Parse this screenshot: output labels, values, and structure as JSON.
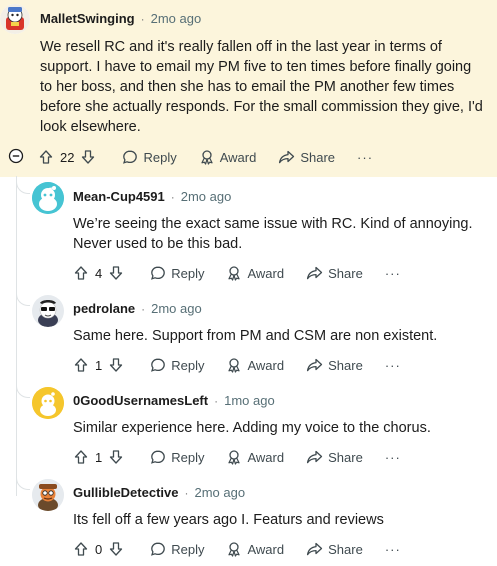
{
  "comments": [
    {
      "user": "MalletSwinging",
      "time": "2mo ago",
      "body_lines": [
        "We resell RC and it's really fallen off in the last year in terms of",
        "support. I have to email my PM five to ten times before finally going",
        "to her boss, and then she has to email the PM another few times",
        "before she actually responds. For the small commission they give, I'd",
        "look elsewhere."
      ],
      "votes": "22",
      "reply": "Reply",
      "award": "Award",
      "share": "Share",
      "more": "···"
    },
    {
      "user": "Mean-Cup4591",
      "time": "2mo ago",
      "body_lines": [
        "We’re seeing the exact same issue with RC. Kind of annoying.",
        "Never used to be this bad."
      ],
      "votes": "4",
      "reply": "Reply",
      "award": "Award",
      "share": "Share",
      "more": "···"
    },
    {
      "user": "pedrolane",
      "time": "2mo ago",
      "body_lines": [
        "Same here. Support from PM and CSM are non existent."
      ],
      "votes": "1",
      "reply": "Reply",
      "award": "Award",
      "share": "Share",
      "more": "···"
    },
    {
      "user": "0GoodUsernamesLeft",
      "time": "1mo ago",
      "body_lines": [
        "Similar experience here. Adding my voice to the chorus."
      ],
      "votes": "1",
      "reply": "Reply",
      "award": "Award",
      "share": "Share",
      "more": "···"
    },
    {
      "user": "GullibleDetective",
      "time": "2mo ago",
      "body_lines": [
        "Its fell off a few years ago I. Featurs and reviews"
      ],
      "votes": "0",
      "reply": "Reply",
      "award": "Award",
      "share": "Share",
      "more": "···"
    }
  ],
  "separator": "·",
  "colors": {
    "highlight_bg": "#fcf5dc",
    "thread_line": "#dfe3e5",
    "meta_gray": "#576f76",
    "avatar_teal": "#46c4d3",
    "avatar_yellow": "#f5c62c"
  },
  "icons": {
    "upvote": "arrow-up-icon",
    "downvote": "arrow-down-icon",
    "reply": "speech-bubble-icon",
    "award": "award-ribbon-icon",
    "share": "share-arrow-icon",
    "collapse": "minus-circle-icon"
  }
}
